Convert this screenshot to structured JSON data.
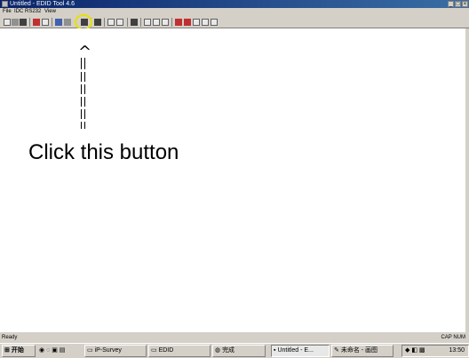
{
  "window": {
    "title": "Untitled - EDID Tool 4.6",
    "min_label": "_",
    "max_label": "□",
    "close_label": "×"
  },
  "menubar": {
    "items": [
      "File",
      "IDC",
      "RS232",
      "View"
    ]
  },
  "toolbar": {
    "highlighted_button_icon": "connect-icon"
  },
  "annotation": {
    "arrow_head": "^",
    "callout_text": "Click this button"
  },
  "statusbar": {
    "status": "Ready",
    "indicators": "CAP NUM"
  },
  "taskbar": {
    "start_label": "开始",
    "quicklaunch_icons": [
      "ie-icon",
      "outlook-icon",
      "desktop-icon",
      "media-icon"
    ],
    "tasks": [
      {
        "label": "iP-Survey",
        "active": false
      },
      {
        "label": "EDID",
        "active": false
      },
      {
        "label": "完成",
        "active": false
      },
      {
        "label": "Untitled - E...",
        "active": true
      },
      {
        "label": "未命名 - 画图",
        "active": false
      }
    ],
    "clock": "13:50"
  },
  "colors": {
    "titlebar_start": "#0a246a",
    "highlight_circle": "#e8e000",
    "chrome": "#d4d0c8"
  }
}
